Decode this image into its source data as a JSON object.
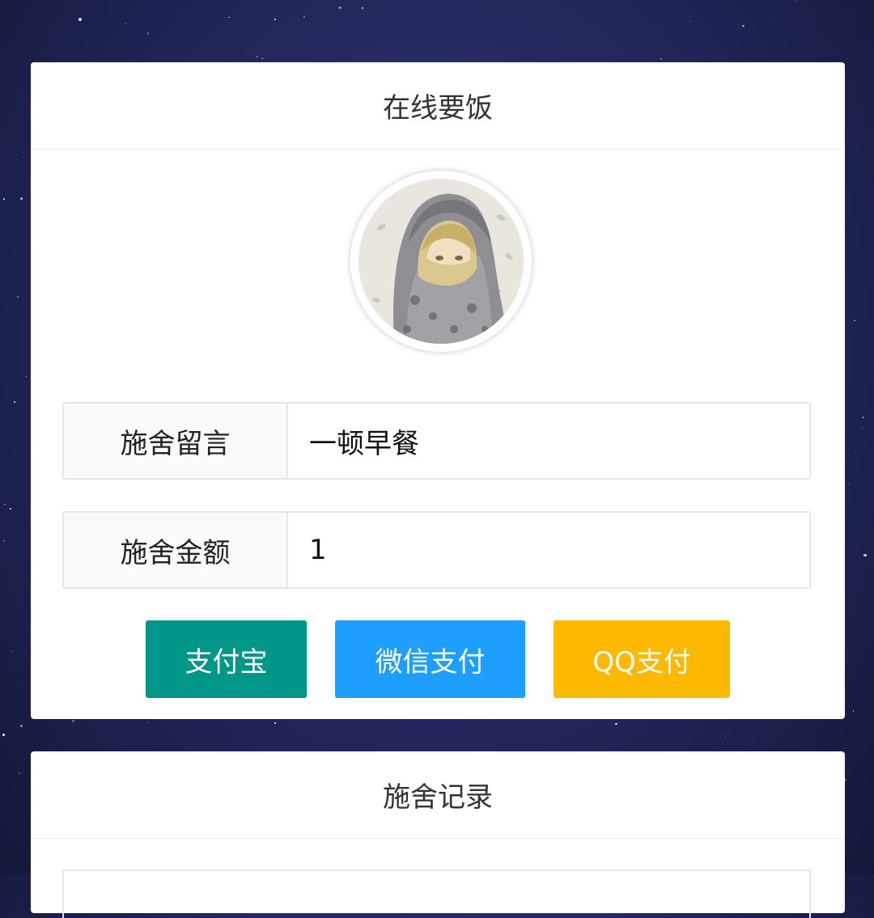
{
  "colors": {
    "background": "#262a62",
    "alipay": "#009688",
    "wechat": "#1e9fff",
    "qq": "#ffb800"
  },
  "donation_card": {
    "title": "在线要饭",
    "avatar_icon": "anime-avatar",
    "message_label": "施舍留言",
    "message_value": "一顿早餐",
    "amount_label": "施舍金额",
    "amount_value": "1",
    "buttons": {
      "alipay": "支付宝",
      "wechat": "微信支付",
      "qq": "QQ支付"
    }
  },
  "records_card": {
    "title": "施舍记录"
  }
}
